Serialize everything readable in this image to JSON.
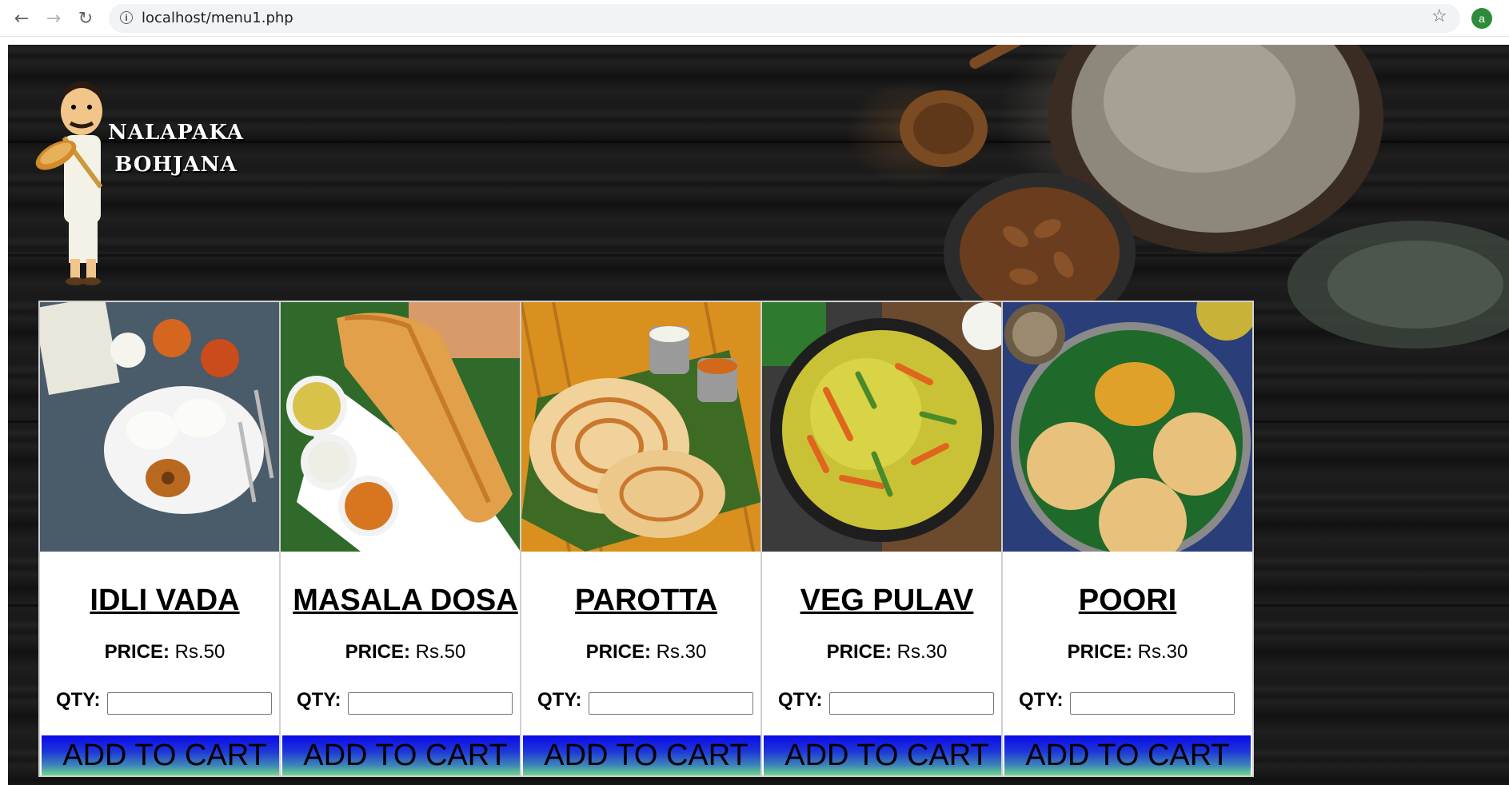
{
  "browser": {
    "url": "localhost/menu1.php",
    "profile_initial": "a"
  },
  "logo": {
    "line1": "NALAPAKA",
    "line2": "BOHJANA"
  },
  "labels": {
    "price": "PRICE:",
    "qty": "QTY:",
    "add_to_cart": "ADD TO CART"
  },
  "menu": [
    {
      "name": "IDLI VADA",
      "price": "Rs.50",
      "image": "idli-vada-plate"
    },
    {
      "name": "MASALA DOSA",
      "price": "Rs.50",
      "image": "masala-dosa-plate"
    },
    {
      "name": "PAROTTA",
      "price": "Rs.30",
      "image": "parotta-plate"
    },
    {
      "name": "VEG PULAV",
      "price": "Rs.30",
      "image": "veg-pulav-bowl"
    },
    {
      "name": "POORI",
      "price": "Rs.30",
      "image": "poori-plate"
    }
  ],
  "colors": {
    "page_background": "#151515",
    "button_gradient_top": "#0a0ae8",
    "button_gradient_bottom": "#6fd98a",
    "card_background": "#ffffff"
  }
}
